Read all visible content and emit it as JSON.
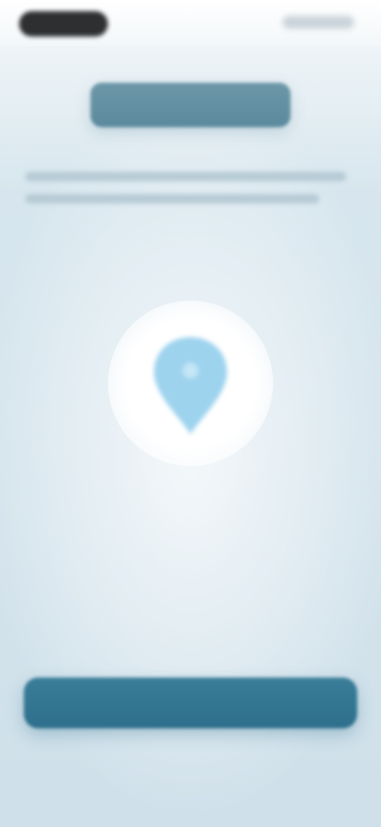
{
  "status_bar": {
    "time_pill": "",
    "system_icons": [
      "signal-icon",
      "wifi-icon",
      "battery-icon"
    ]
  },
  "header": {
    "title": ""
  },
  "description": {
    "text": ""
  },
  "center": {
    "icon": "location-pin-icon",
    "icon_color": "#9ed3ee",
    "halo_color": "#ffffff"
  },
  "primary_action": {
    "label": ""
  },
  "colors": {
    "header_tab": "#5f8ea1",
    "primary_button": "#327795",
    "background": "#d4e4ec"
  }
}
